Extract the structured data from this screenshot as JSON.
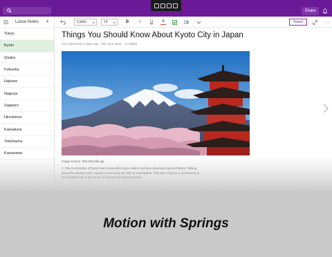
{
  "titlebar": {
    "share_label": "Share",
    "accent": "#6a1a96"
  },
  "sidebar": {
    "title": "Loose Notes",
    "add_label": "+",
    "items": [
      {
        "label": "Tokyo"
      },
      {
        "label": "Kyoto",
        "active": true
      },
      {
        "label": "Osaka"
      },
      {
        "label": "Fukuoka"
      },
      {
        "label": "Hakone"
      },
      {
        "label": "Nagoya"
      },
      {
        "label": "Sapporo"
      },
      {
        "label": "Hiroshima"
      },
      {
        "label": "Kamakura"
      },
      {
        "label": "Yokohama"
      },
      {
        "label": "Kanazawa"
      }
    ]
  },
  "toolbar": {
    "font": "Calibri",
    "size": "14",
    "bold": "B",
    "italic": "I",
    "underline": "U",
    "font_color": "A",
    "insert_label": "Insert"
  },
  "note": {
    "title": "Things You Should Know About Kyoto City in Japan",
    "meta": "You edited this 5 days ago  ·  9th June 2016  ·  11:53PM",
    "image_alt": "Mount Fuji with the Chureito pagoda and cherry blossoms",
    "caption": "Image Source: http://tripzilla.sg/",
    "paragraph": "1. The Central part of Kyoto has its beautiful Kyoto station and also amazing Imperial Palace. Talking about the Western part, Kyoto is covered by the hills of Arashiyama. This part of Kyoto is considered to be beautiful both in the sense of history and natural wonder."
  },
  "banner": {
    "text": "Motion with Springs"
  }
}
